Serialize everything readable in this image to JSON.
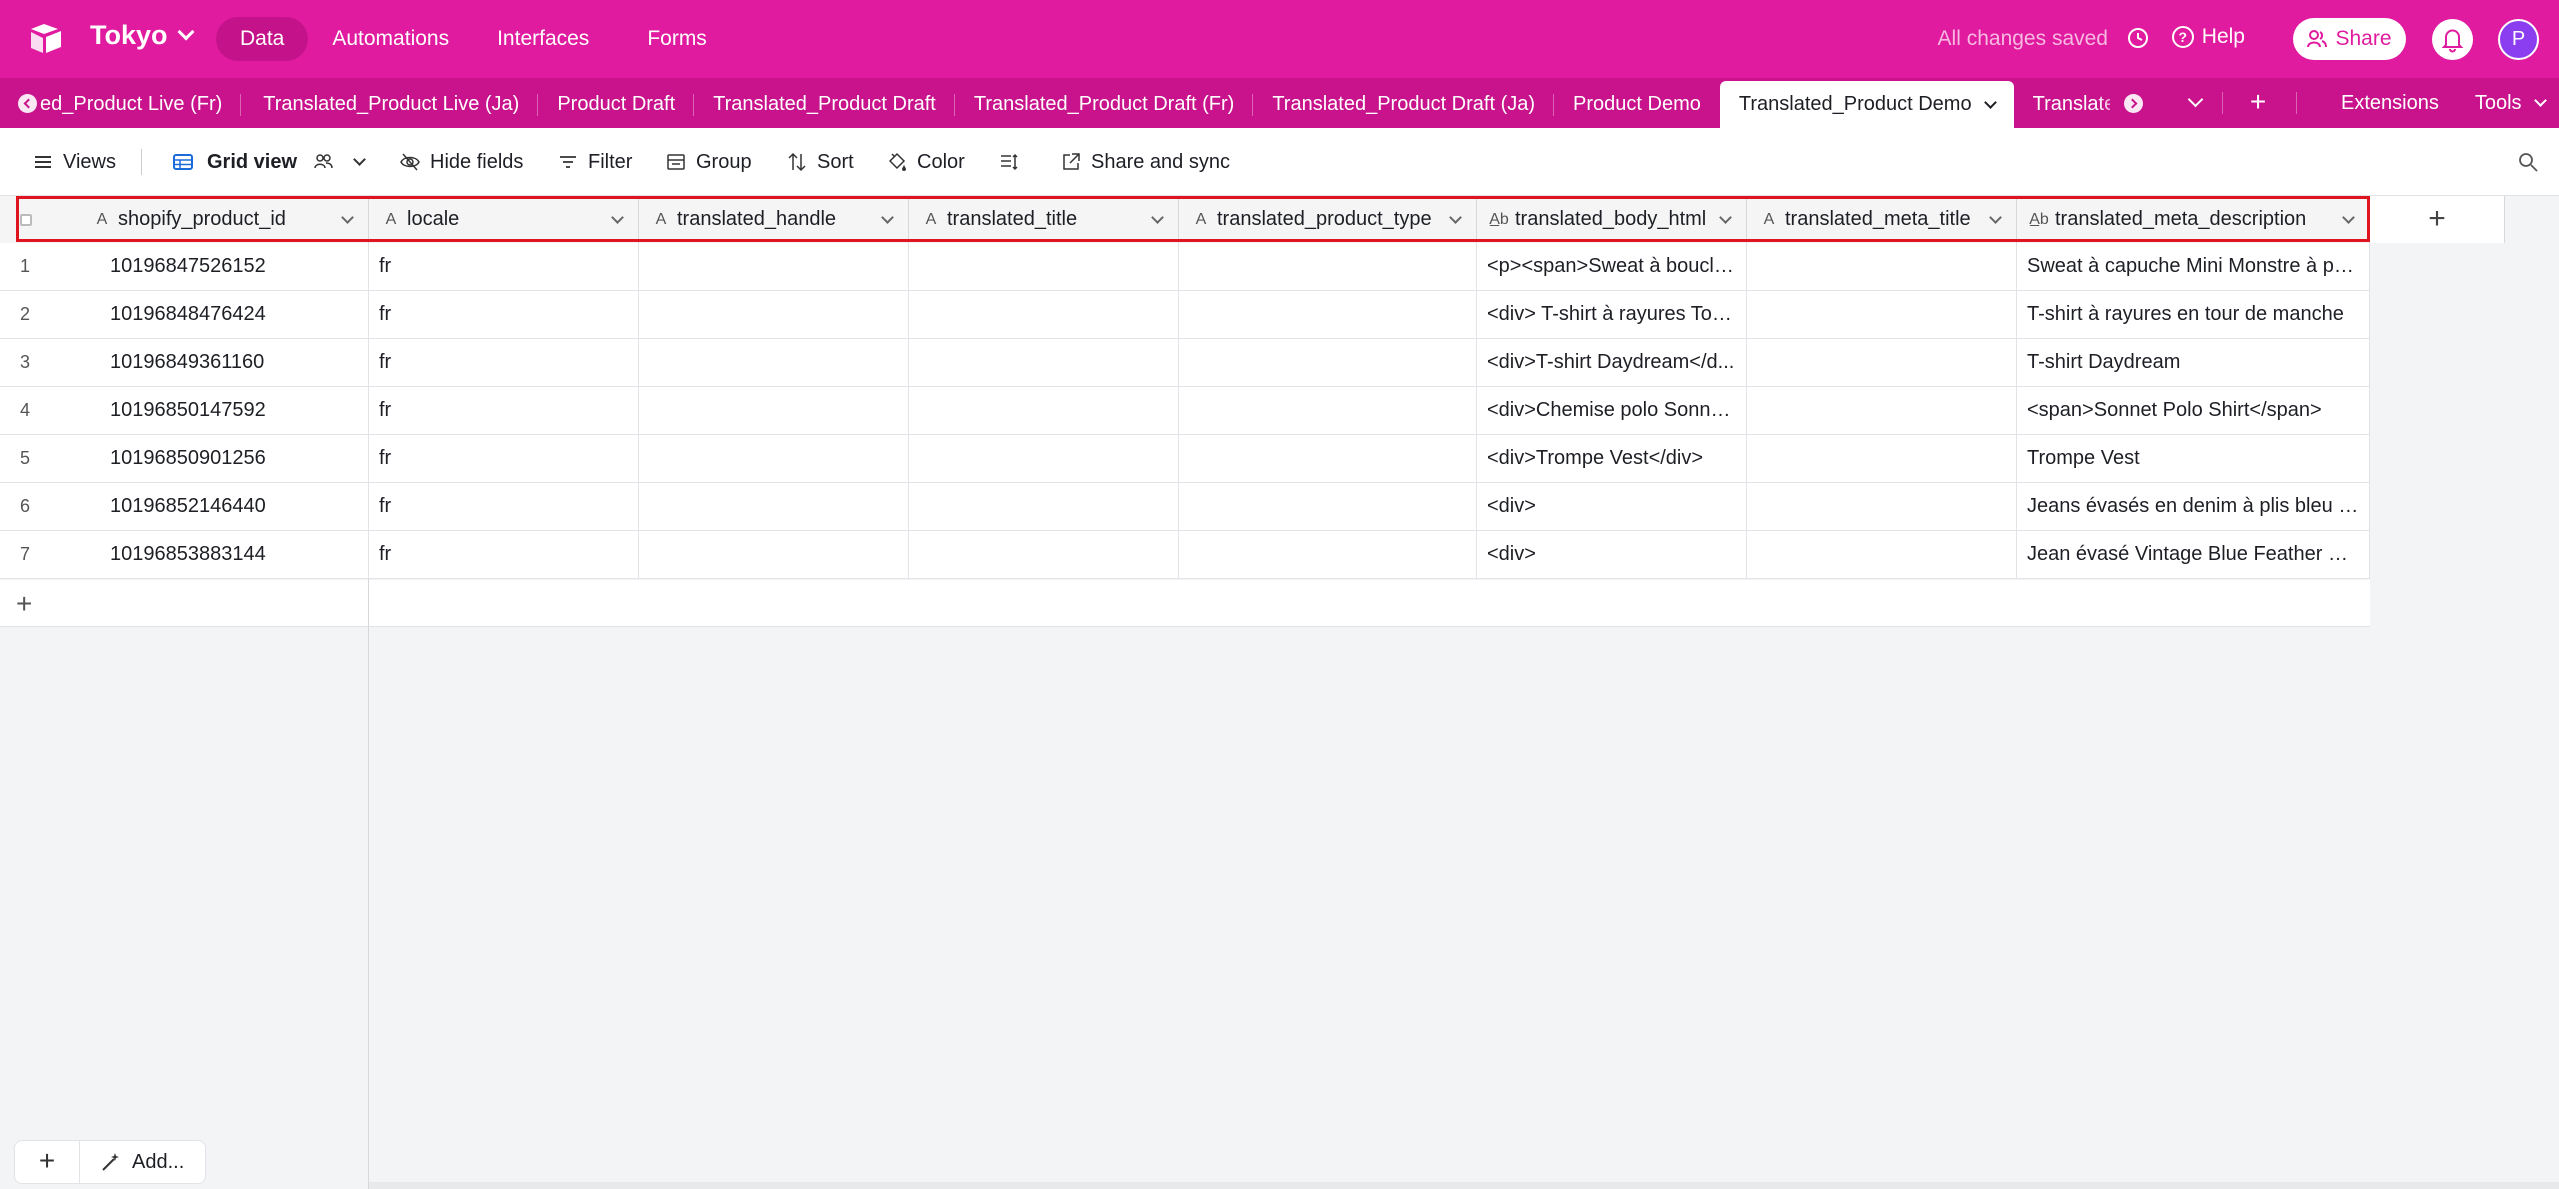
{
  "app": {
    "base_name": "Tokyo",
    "nav": [
      "Data",
      "Automations",
      "Interfaces",
      "Forms"
    ],
    "nav_active": "Data",
    "status": "All changes saved",
    "help": "Help",
    "share": "Share",
    "avatar_initial": "P",
    "brand_color": "#e01b9f"
  },
  "tabs": {
    "items": [
      "ed_Product Live (Fr)",
      "Translated_Product Live (Ja)",
      "Product Draft",
      "Translated_Product Draft",
      "Translated_Product Draft (Fr)",
      "Translated_Product Draft (Ja)",
      "Product Demo",
      "Translated_Product Demo",
      "Translated_Product"
    ],
    "active": "Translated_Product Demo",
    "extensions": "Extensions",
    "tools": "Tools"
  },
  "toolbar": {
    "views": "Views",
    "grid_view": "Grid view",
    "hide_fields": "Hide fields",
    "filter": "Filter",
    "group": "Group",
    "sort": "Sort",
    "color": "Color",
    "share_sync": "Share and sync"
  },
  "table": {
    "columns": [
      {
        "name": "shopify_product_id",
        "icon": "text-icon"
      },
      {
        "name": "locale",
        "icon": "text-icon"
      },
      {
        "name": "translated_handle",
        "icon": "text-icon"
      },
      {
        "name": "translated_title",
        "icon": "text-icon"
      },
      {
        "name": "translated_product_type",
        "icon": "text-icon"
      },
      {
        "name": "translated_body_html",
        "icon": "long-text-icon"
      },
      {
        "name": "translated_meta_title",
        "icon": "text-icon"
      },
      {
        "name": "translated_meta_description",
        "icon": "long-text-icon"
      }
    ],
    "rows": [
      {
        "n": "1",
        "id": "10196847526152",
        "locale": "fr",
        "body": "<p><span>Sweat à boucle...",
        "meta_desc": "Sweat à capuche Mini Monstre à poi..."
      },
      {
        "n": "2",
        "id": "10196848476424",
        "locale": "fr",
        "body": "<div> T-shirt à rayures Tou...",
        "meta_desc": "T-shirt à rayures en tour de manche"
      },
      {
        "n": "3",
        "id": "10196849361160",
        "locale": "fr",
        "body": "<div>T-shirt Daydream</d...",
        "meta_desc": "T-shirt Daydream"
      },
      {
        "n": "4",
        "id": "10196850147592",
        "locale": "fr",
        "body": "<div>Chemise polo Sonnet...",
        "meta_desc": "<span>Sonnet Polo Shirt</span>"
      },
      {
        "n": "5",
        "id": "10196850901256",
        "locale": "fr",
        "body": "<div>Trompe Vest</div>",
        "meta_desc": "Trompe Vest"
      },
      {
        "n": "6",
        "id": "10196852146440",
        "locale": "fr",
        "body": "<div>",
        "meta_desc": "Jeans évasés en denim à plis bleu in..."
      },
      {
        "n": "7",
        "id": "10196853883144",
        "locale": "fr",
        "body": "<div>",
        "meta_desc": "Jean évasé Vintage Blue Feather Drift"
      }
    ]
  },
  "bottom": {
    "add_label": "Add..."
  }
}
